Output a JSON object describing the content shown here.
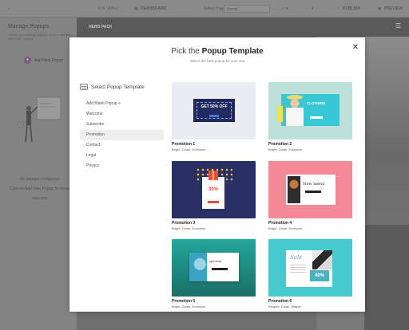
{
  "topbar": {
    "back_icon": "chevron-left-icon",
    "url": "XYK UI/Prc",
    "dashboard": "DASHBOARD",
    "select_page_label": "Select Page",
    "selected_page": "Home",
    "publish": "PUBLISH",
    "preview": "PREVIEW"
  },
  "left_panel": {
    "title": "Manage Popups",
    "description": "Create and manage popups on your website with more options.",
    "add_button": "Add New Popup",
    "empty_line1": "No popups configured.",
    "empty_line2": "Click on Add New Popup to create",
    "empty_line3": "new one"
  },
  "background": {
    "hero_label": "HERO PACK"
  },
  "modal": {
    "title_prefix": "Pick the",
    "title_bold": "Popup Template",
    "subtitle": "Select the best popup for your site",
    "sidebar_title": "Select Popup Template",
    "categories": [
      "Add Blank Popup +",
      "Welcome",
      "Subscribe",
      "Promotion",
      "Contact",
      "Legal",
      "Privacy"
    ],
    "active_category": "Promotion",
    "templates": [
      {
        "name": "Promotion 1",
        "tags": "Bright, Clean, Exclusive",
        "preview_text": "GET 50% OFF"
      },
      {
        "name": "Promotion 2",
        "tags": "Bright, Clean, Exclusive",
        "preview_text": "CLOTHING"
      },
      {
        "name": "Promotion 3",
        "tags": "Bright, Clean, Exclusive",
        "preview_text": "30%"
      },
      {
        "name": "Promotion 4",
        "tags": "Bright, Clean, Exclusive",
        "preview_text": "New menu"
      },
      {
        "name": "Promotion 5",
        "tags": "Bright, Clean, Exclusive",
        "preview_text": "spa time"
      },
      {
        "name": "Promotion 6",
        "tags": "Elegant, Clean, Simple",
        "preview_text": "Sale",
        "preview_text2": "40%"
      }
    ]
  }
}
